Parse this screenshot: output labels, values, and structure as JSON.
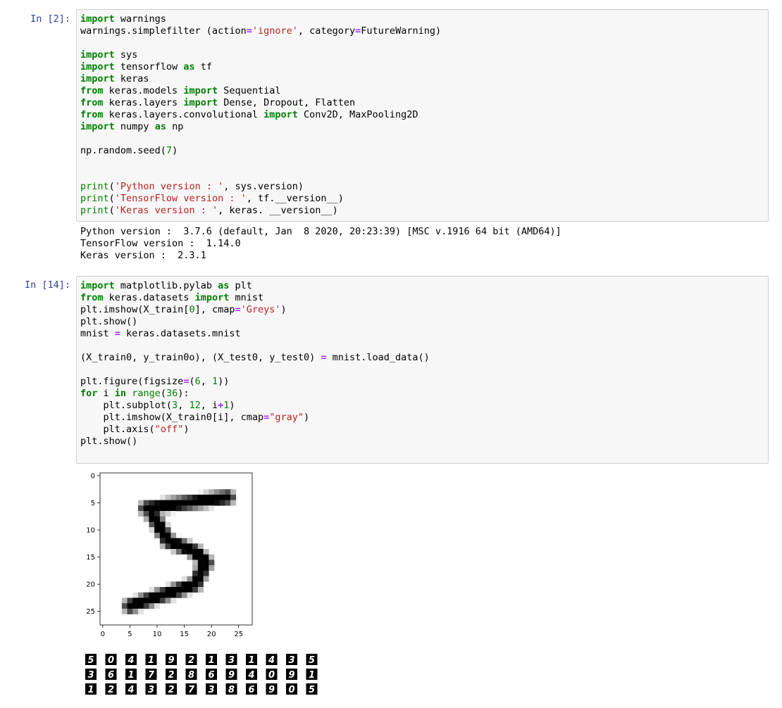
{
  "cells": [
    {
      "prompt": "In [2]:",
      "code": [
        [
          [
            "kw",
            "import"
          ],
          [
            "t",
            " warnings"
          ]
        ],
        [
          [
            "t",
            "warnings.simplefilter (action"
          ],
          [
            "op",
            "="
          ],
          [
            "str",
            "'ignore'"
          ],
          [
            "t",
            ", category"
          ],
          [
            "op",
            "="
          ],
          [
            "t",
            "FutureWarning)"
          ]
        ],
        [],
        [
          [
            "kw",
            "import"
          ],
          [
            "t",
            " sys"
          ]
        ],
        [
          [
            "kw",
            "import"
          ],
          [
            "t",
            " tensorflow "
          ],
          [
            "kw",
            "as"
          ],
          [
            "t",
            " tf"
          ]
        ],
        [
          [
            "kw",
            "import"
          ],
          [
            "t",
            " keras"
          ]
        ],
        [
          [
            "kw",
            "from"
          ],
          [
            "t",
            " keras.models "
          ],
          [
            "kw",
            "import"
          ],
          [
            "t",
            " Sequential"
          ]
        ],
        [
          [
            "kw",
            "from"
          ],
          [
            "t",
            " keras.layers "
          ],
          [
            "kw",
            "import"
          ],
          [
            "t",
            " Dense, Dropout, Flatten"
          ]
        ],
        [
          [
            "kw",
            "from"
          ],
          [
            "t",
            " keras.layers.convolutional "
          ],
          [
            "kw",
            "import"
          ],
          [
            "t",
            " Conv2D, MaxPooling2D"
          ]
        ],
        [
          [
            "kw",
            "import"
          ],
          [
            "t",
            " numpy "
          ],
          [
            "kw",
            "as"
          ],
          [
            "t",
            " np"
          ]
        ],
        [],
        [
          [
            "t",
            "np.random.seed("
          ],
          [
            "num",
            "7"
          ],
          [
            "t",
            ")"
          ]
        ],
        [],
        [],
        [
          [
            "bi",
            "print"
          ],
          [
            "t",
            "("
          ],
          [
            "str",
            "'Python version : '"
          ],
          [
            "t",
            ", sys.version)"
          ]
        ],
        [
          [
            "bi",
            "print"
          ],
          [
            "t",
            "("
          ],
          [
            "str",
            "'TensorFlow version : '"
          ],
          [
            "t",
            ", tf.__version__)"
          ]
        ],
        [
          [
            "bi",
            "print"
          ],
          [
            "t",
            "("
          ],
          [
            "str",
            "'Keras version : '"
          ],
          [
            "t",
            ", keras. __version__)"
          ]
        ]
      ],
      "output": [
        "Python version :  3.7.6 (default, Jan  8 2020, 20:23:39) [MSC v.1916 64 bit (AMD64)]",
        "TensorFlow version :  1.14.0",
        "Keras version :  2.3.1"
      ]
    },
    {
      "prompt": "In [14]:",
      "code": [
        [
          [
            "kw",
            "import"
          ],
          [
            "t",
            " matplotlib.pylab "
          ],
          [
            "kw",
            "as"
          ],
          [
            "t",
            " plt"
          ]
        ],
        [
          [
            "kw",
            "from"
          ],
          [
            "t",
            " keras.datasets "
          ],
          [
            "kw",
            "import"
          ],
          [
            "t",
            " mnist"
          ]
        ],
        [
          [
            "t",
            "plt.imshow(X_train["
          ],
          [
            "num",
            "0"
          ],
          [
            "t",
            "], cmap"
          ],
          [
            "op",
            "="
          ],
          [
            "str",
            "'Greys'"
          ],
          [
            "t",
            ")"
          ]
        ],
        [
          [
            "t",
            "plt.show()"
          ]
        ],
        [
          [
            "t",
            "mnist "
          ],
          [
            "op",
            "="
          ],
          [
            "t",
            " keras.datasets.mnist"
          ]
        ],
        [],
        [
          [
            "t",
            "(X_train0, y_train0o), (X_test0, y_test0) "
          ],
          [
            "op",
            "="
          ],
          [
            "t",
            " mnist.load_data()"
          ]
        ],
        [],
        [
          [
            "t",
            "plt.figure(figsize"
          ],
          [
            "op",
            "="
          ],
          [
            "t",
            "("
          ],
          [
            "num",
            "6"
          ],
          [
            "t",
            ", "
          ],
          [
            "num",
            "1"
          ],
          [
            "t",
            "))"
          ]
        ],
        [
          [
            "kw",
            "for"
          ],
          [
            "t",
            " i "
          ],
          [
            "kw",
            "in"
          ],
          [
            "t",
            " "
          ],
          [
            "bi",
            "range"
          ],
          [
            "t",
            "("
          ],
          [
            "num",
            "36"
          ],
          [
            "t",
            "):"
          ]
        ],
        [
          [
            "t",
            "    plt.subplot("
          ],
          [
            "num",
            "3"
          ],
          [
            "t",
            ", "
          ],
          [
            "num",
            "12"
          ],
          [
            "t",
            ", i"
          ],
          [
            "op",
            "+"
          ],
          [
            "num",
            "1"
          ],
          [
            "t",
            ")"
          ]
        ],
        [
          [
            "t",
            "    plt.imshow(X_train0[i], cmap"
          ],
          [
            "op",
            "="
          ],
          [
            "str",
            "\"gray\""
          ],
          [
            "t",
            ")"
          ]
        ],
        [
          [
            "t",
            "    plt.axis("
          ],
          [
            "str",
            "\"off\""
          ],
          [
            "t",
            ")"
          ]
        ],
        [
          [
            "t",
            "plt.show()"
          ]
        ]
      ]
    }
  ],
  "figure": {
    "x_ticks": [
      "0",
      "5",
      "10",
      "15",
      "20",
      "25"
    ],
    "y_ticks": [
      "0",
      "5",
      "10",
      "15",
      "20",
      "25"
    ]
  },
  "digit_rows": [
    [
      "5",
      "0",
      "4",
      "1",
      "9",
      "2",
      "1",
      "3",
      "1",
      "4",
      "3",
      "5"
    ],
    [
      "3",
      "6",
      "1",
      "7",
      "2",
      "8",
      "6",
      "9",
      "4",
      "0",
      "9",
      "1"
    ],
    [
      "1",
      "2",
      "4",
      "3",
      "2",
      "7",
      "3",
      "8",
      "6",
      "9",
      "0",
      "5"
    ]
  ]
}
